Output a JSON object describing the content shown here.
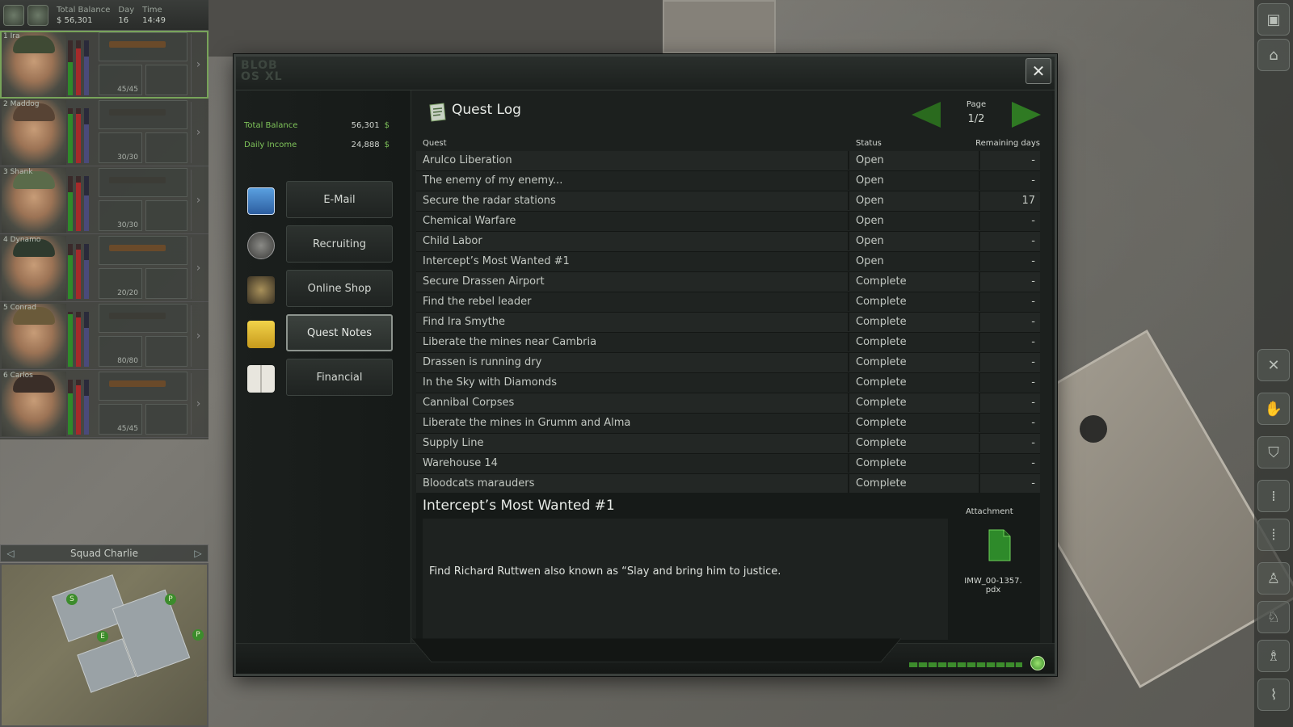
{
  "hud": {
    "balance_label": "Total Balance",
    "balance_value": "$ 56,301",
    "day_label": "Day",
    "day_value": "16",
    "time_label": "Time",
    "time_value": "14:49"
  },
  "squad": {
    "name": "Squad Charlie",
    "mercs": [
      {
        "name": "1 Ira",
        "ammo": "45/45"
      },
      {
        "name": "2 Maddog",
        "ammo": "30/30"
      },
      {
        "name": "3 Shank",
        "ammo": "30/30"
      },
      {
        "name": "4 Dynamo",
        "ammo": "20/20"
      },
      {
        "name": "5 Conrad",
        "ammo": "80/80"
      },
      {
        "name": "6 Carlos",
        "ammo": "45/45"
      }
    ]
  },
  "laptop": {
    "os_logo_line1": "BLOB",
    "os_logo_line2": "OS XL",
    "finance": {
      "total_balance_label": "Total Balance",
      "total_balance_value": "56,301",
      "daily_income_label": "Daily Income",
      "daily_income_value": "24,888",
      "currency": "$"
    },
    "menu": [
      {
        "label": "E-Mail",
        "icon": "mail-icon"
      },
      {
        "label": "Recruiting",
        "icon": "soldier-icon"
      },
      {
        "label": "Online Shop",
        "icon": "shop-icon"
      },
      {
        "label": "Quest Notes",
        "icon": "folder-search-icon",
        "selected": true
      },
      {
        "label": "Financial",
        "icon": "book-icon"
      }
    ]
  },
  "quest_log": {
    "title": "Quest Log",
    "page_label": "Page",
    "page_value": "1/2",
    "columns": {
      "quest": "Quest",
      "status": "Status",
      "remaining": "Remaining days"
    },
    "rows": [
      {
        "quest": "Arulco Liberation",
        "status": "Open",
        "days": "-"
      },
      {
        "quest": "The enemy of my enemy...",
        "status": "Open",
        "days": "-"
      },
      {
        "quest": "Secure the radar stations",
        "status": "Open",
        "days": "17"
      },
      {
        "quest": "Chemical Warfare",
        "status": "Open",
        "days": "-"
      },
      {
        "quest": "Child Labor",
        "status": "Open",
        "days": "-"
      },
      {
        "quest": "Intercept’s Most Wanted #1",
        "status": "Open",
        "days": "-"
      },
      {
        "quest": "Secure Drassen Airport",
        "status": "Complete",
        "days": "-"
      },
      {
        "quest": "Find the rebel leader",
        "status": "Complete",
        "days": "-"
      },
      {
        "quest": "Find Ira Smythe",
        "status": "Complete",
        "days": "-"
      },
      {
        "quest": "Liberate the mines near Cambria",
        "status": "Complete",
        "days": "-"
      },
      {
        "quest": "Drassen is running dry",
        "status": "Complete",
        "days": "-"
      },
      {
        "quest": "In the Sky with Diamonds",
        "status": "Complete",
        "days": "-"
      },
      {
        "quest": "Cannibal Corpses",
        "status": "Complete",
        "days": "-"
      },
      {
        "quest": "Liberate the mines in Grumm and Alma",
        "status": "Complete",
        "days": "-"
      },
      {
        "quest": "Supply Line",
        "status": "Complete",
        "days": "-"
      },
      {
        "quest": "Warehouse 14",
        "status": "Complete",
        "days": "-"
      },
      {
        "quest": "Bloodcats marauders",
        "status": "Complete",
        "days": "-"
      }
    ],
    "detail": {
      "title": "Intercept’s Most Wanted #1",
      "text": "Find Richard Ruttwen also known as “Slay and bring him to justice.",
      "attachment_label": "Attachment",
      "attachment_name": "IMW_00-1357. pdx"
    }
  },
  "colors": {
    "accent_green": "#7fc45a",
    "arrow_green": "#2f7a23"
  }
}
